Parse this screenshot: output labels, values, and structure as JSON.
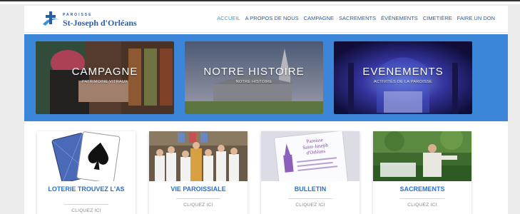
{
  "brand": {
    "small_text": "PAROISSE",
    "name": "St-Joseph d'Orléans",
    "color": "#2a5ea8"
  },
  "nav": {
    "items": [
      {
        "label": "ACCUEIL"
      },
      {
        "label": "A PROPOS DE NOUS"
      },
      {
        "label": "CAMPAGNE"
      },
      {
        "label": "SACREMENTS"
      },
      {
        "label": "ÉVÉNEMENTS"
      },
      {
        "label": "CIMETIÈRE"
      },
      {
        "label": "FAIRE UN DON"
      }
    ],
    "active_color": "#3aa0e0",
    "color": "#2d5ba0"
  },
  "hero": {
    "background": "#3b86d9",
    "tiles": [
      {
        "title": "CAMPAGNE",
        "subtitle": "PATRIMOINE VITRAUX",
        "image": "stained-glass-restoration-photo"
      },
      {
        "title": "NOTRE HISTOIRE",
        "subtitle": "NOTRE HISTOIRE",
        "image": "stone-church-photo"
      },
      {
        "title": "EVENEMENTS",
        "subtitle": "ACTIVITÉS DE LA PAROISSE",
        "image": "illuminated-church-interior-photo"
      }
    ]
  },
  "cards": [
    {
      "title": "LOTERIE TROUVEZ L'AS",
      "link": "CLIQUEZ ICI",
      "image": "ace-of-spades-card"
    },
    {
      "title": "VIE PAROISSIALE",
      "link": "CLIQUEZ ICI",
      "image": "altar-servers-photo"
    },
    {
      "title": "BULLETIN",
      "link": "CLIQUEZ ICI",
      "image": "parish-bulletin-flyer"
    },
    {
      "title": "SACREMENTS",
      "link": "CLIQUEZ ICI",
      "image": "outdoor-mass-photo"
    }
  ],
  "bulletin_flyer": {
    "line1": "Paroisse",
    "line2": "Saint-Joseph",
    "line3": "d'Orléans"
  }
}
